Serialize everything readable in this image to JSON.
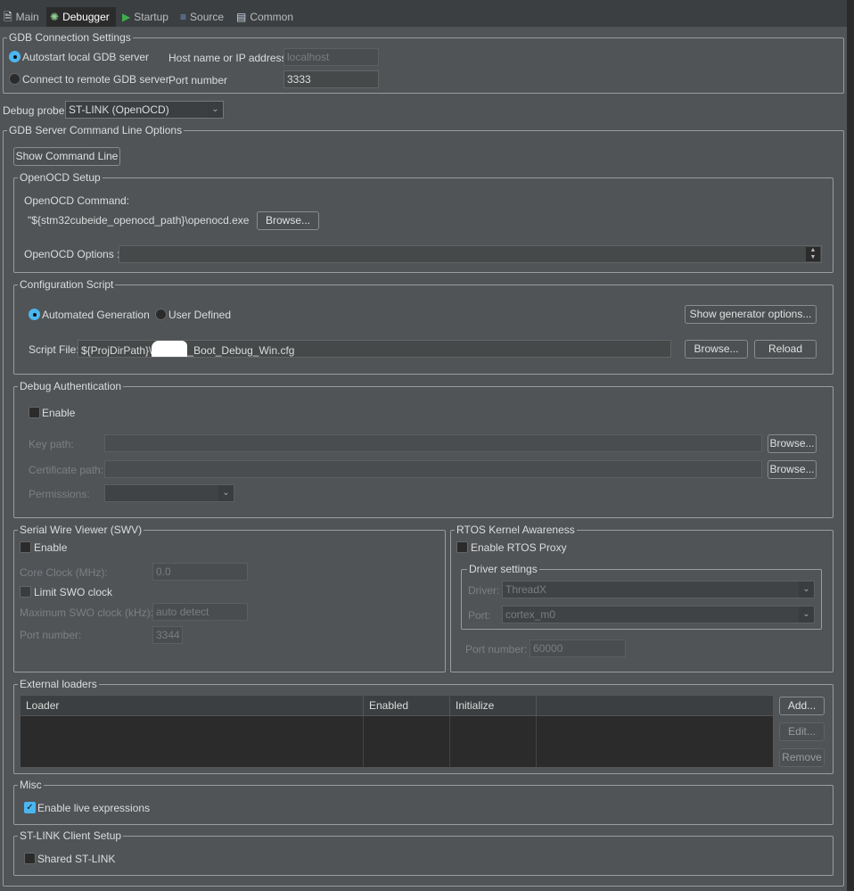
{
  "tabs": [
    {
      "label": "Main",
      "icon": "document-icon"
    },
    {
      "label": "Debugger",
      "icon": "bug-icon",
      "selected": true
    },
    {
      "label": "Startup",
      "icon": "play-icon"
    },
    {
      "label": "Source",
      "icon": "source-icon"
    },
    {
      "label": "Common",
      "icon": "table-icon"
    }
  ],
  "gdb_connection": {
    "title": "GDB Connection Settings",
    "autostart": "Autostart local GDB server",
    "remote": "Connect to remote GDB server",
    "selected": "autostart",
    "host_label": "Host name or IP address",
    "host_value": "localhost",
    "port_label": "Port number",
    "port_value": "3333"
  },
  "debug_probe": {
    "label": "Debug probe",
    "value": "ST-LINK (OpenOCD)"
  },
  "gdb_server": {
    "title": "GDB Server Command Line Options",
    "show_cmd": "Show Command Line"
  },
  "openocd": {
    "title": "OpenOCD Setup",
    "command_label": "OpenOCD Command:",
    "command_value": "\"${stm32cubeide_openocd_path}\\openocd.exe\"",
    "browse": "Browse...",
    "options_label": "OpenOCD Options :",
    "options_value": ""
  },
  "config_script": {
    "title": "Configuration Script",
    "auto": "Automated Generation",
    "user": "User Defined",
    "selected": "auto",
    "show_gen": "Show generator options...",
    "script_label": "Script File:",
    "script_value_start": "${ProjDirPath}\\",
    "script_value_end": "_Boot_Debug_Win.cfg",
    "browse": "Browse...",
    "reload": "Reload"
  },
  "debug_auth": {
    "title": "Debug Authentication",
    "enable": "Enable",
    "enabled": false,
    "key_label": "Key path:",
    "cert_label": "Certificate path:",
    "perm_label": "Permissions:",
    "browse": "Browse..."
  },
  "swv": {
    "title": "Serial Wire Viewer (SWV)",
    "enable": "Enable",
    "enabled": false,
    "core_clock_label": "Core Clock (MHz):",
    "core_clock_value": "0.0",
    "limit_swo": "Limit SWO clock",
    "max_swo_label": "Maximum SWO clock (kHz):",
    "max_swo_value": "auto detect",
    "port_label": "Port number:",
    "port_value": "3344"
  },
  "rtos": {
    "title": "RTOS Kernel Awareness",
    "enable": "Enable RTOS Proxy",
    "enabled": false,
    "driver_title": "Driver settings",
    "driver_label": "Driver:",
    "driver_value": "ThreadX",
    "port_label": "Port:",
    "port_value": "cortex_m0",
    "port_number_label": "Port number:",
    "port_number_value": "60000"
  },
  "external_loaders": {
    "title": "External loaders",
    "columns": [
      "Loader",
      "Enabled",
      "Initialize",
      ""
    ],
    "add": "Add...",
    "edit": "Edit...",
    "remove": "Remove"
  },
  "misc": {
    "title": "Misc",
    "live_expr": "Enable live expressions",
    "live_checked": true
  },
  "stlink": {
    "title": "ST-LINK Client Setup",
    "shared": "Shared ST-LINK",
    "shared_checked": false
  },
  "colors": {
    "background": "#505457",
    "accent": "#4ab6f0"
  }
}
